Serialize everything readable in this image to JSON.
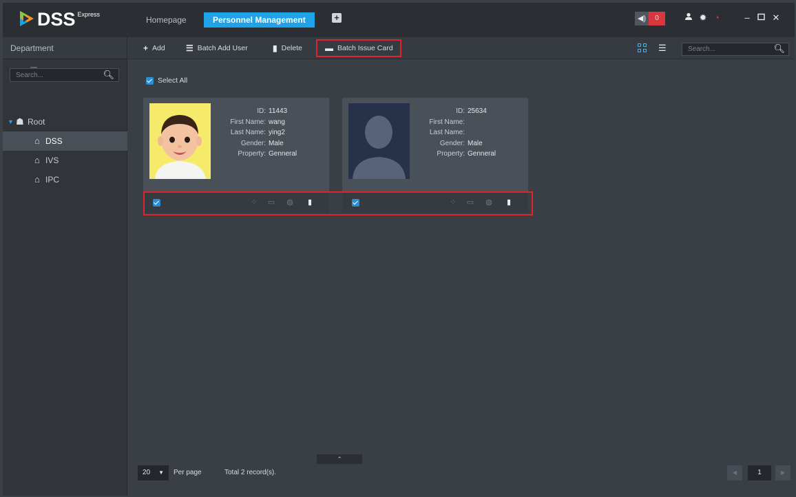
{
  "app": {
    "logo_text": "DSS",
    "logo_sup": "Express"
  },
  "titlebar": {
    "tab_home": "Homepage",
    "tab_active": "Personnel Management",
    "alarm_count": "0"
  },
  "left": {
    "header": "Department",
    "search_placeholder": "Search...",
    "tree": [
      {
        "label": "Root"
      },
      {
        "label": "DSS"
      },
      {
        "label": "IVS"
      },
      {
        "label": "IPC"
      }
    ]
  },
  "toolbar": {
    "add": "Add",
    "batch_add_user": "Batch Add User",
    "delete": "Delete",
    "batch_issue_card": "Batch Issue Card",
    "search_placeholder": "Search..."
  },
  "select_all": "Select All",
  "cards": [
    {
      "id_label": "ID:",
      "id": "11443",
      "first_label": "First Name:",
      "first": "wang",
      "last_label": "Last Name:",
      "last": "ying2",
      "gender_label": "Gender:",
      "gender": "Male",
      "property_label": "Property:",
      "property": "Genneral"
    },
    {
      "id_label": "ID:",
      "id": "25634",
      "first_label": "First Name:",
      "first": "",
      "last_label": "Last Name:",
      "last": "",
      "gender_label": "Gender:",
      "gender": "Male",
      "property_label": "Property:",
      "property": "Genneral"
    }
  ],
  "pagination": {
    "per_page_value": "20",
    "per_page_label": "Per page",
    "total": "Total 2 record(s).",
    "page": "1"
  },
  "colors": {
    "accent": "#1fa3e8",
    "highlight": "#e2232a",
    "background": "#3a3f45"
  }
}
